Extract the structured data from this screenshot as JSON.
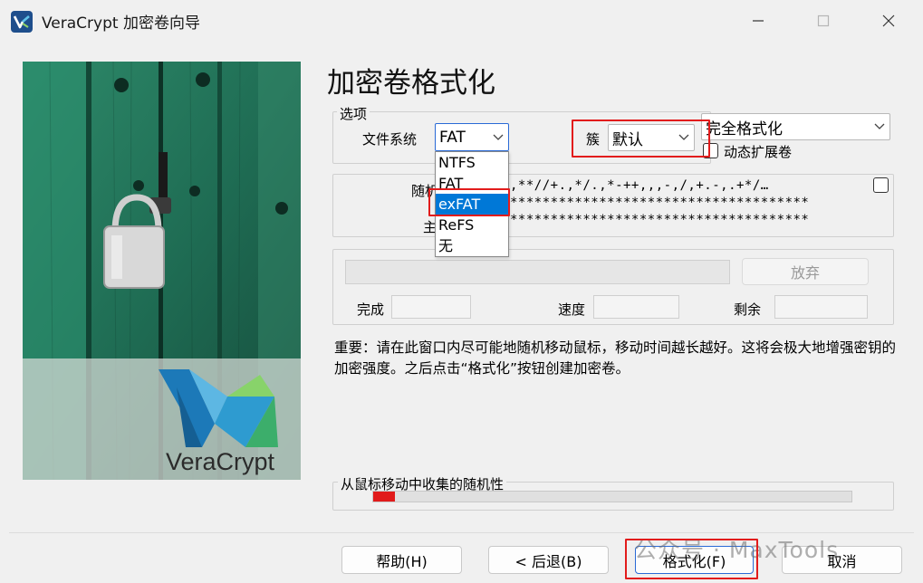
{
  "window": {
    "title": "VeraCrypt 加密卷向导",
    "icon": "veracrypt-logo-icon",
    "controls": [
      "minimize-icon",
      "maximize-icon",
      "close-icon"
    ]
  },
  "left_panel": {
    "brand_text": "VeraCrypt",
    "image": "padlock-on-green-door"
  },
  "heading": "加密卷格式化",
  "options": {
    "group_label": "选项",
    "filesystem_label": "文件系统",
    "filesystem_value": "FAT",
    "filesystem_options": [
      "NTFS",
      "FAT",
      "exFAT",
      "ReFS",
      "无"
    ],
    "highlighted_option": "exFAT",
    "cluster_label": "簇",
    "cluster_value": "默认",
    "format_mode_value": "完全格式化",
    "dynamic_label": "动态扩展卷",
    "dynamic_checked": false
  },
  "random_pool": {
    "label_partial_1": "随机",
    "label_partial_2": "主",
    "line1": ",**//+.,*/.,*-++,,,-,/,+.-,.+*/…",
    "line2": "*************************************",
    "line3": "*************************************",
    "show_checked": false
  },
  "progress": {
    "abort_label": "放弃",
    "done_label": "完成",
    "speed_label": "速度",
    "remaining_label": "剩余"
  },
  "notice": "重要：请在此窗口内尽可能地随机移动鼠标，移动时间越长越好。这将会极大地增强密钥的加密强度。之后点击“格式化”按钮创建加密卷。",
  "entropy": {
    "label": "从鼠标移动中收集的随机性",
    "level": 0.045,
    "color": "#e11a1a"
  },
  "buttons": {
    "help": "帮助(H)",
    "back": "< 后退(B)",
    "format": "格式化(F)",
    "cancel": "取消"
  },
  "watermark": "公众号 · MaxTools",
  "colors": {
    "highlight_red": "#e21c1c",
    "selection_blue": "#0078d7"
  }
}
